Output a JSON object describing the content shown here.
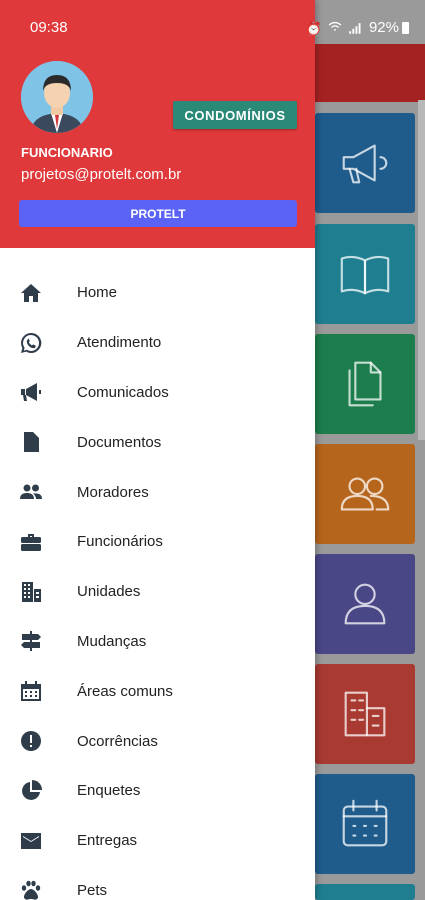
{
  "status_bar": {
    "time": "09:38",
    "battery": "92%"
  },
  "drawer": {
    "condominios_button": "CONDOMÍNIOS",
    "role": "FUNCIONARIO",
    "email": "projetos@protelt.com.br",
    "company_button": "PROTELT"
  },
  "menu": [
    {
      "label": "Home",
      "icon": "home-icon"
    },
    {
      "label": "Atendimento",
      "icon": "whatsapp-icon"
    },
    {
      "label": "Comunicados",
      "icon": "megaphone-icon"
    },
    {
      "label": "Documentos",
      "icon": "document-icon"
    },
    {
      "label": "Moradores",
      "icon": "people-icon"
    },
    {
      "label": "Funcionários",
      "icon": "briefcase-icon"
    },
    {
      "label": "Unidades",
      "icon": "building-icon"
    },
    {
      "label": "Mudanças",
      "icon": "signpost-icon"
    },
    {
      "label": "Áreas comuns",
      "icon": "calendar-icon"
    },
    {
      "label": "Ocorrências",
      "icon": "alert-icon"
    },
    {
      "label": "Enquetes",
      "icon": "pie-chart-icon"
    },
    {
      "label": "Entregas",
      "icon": "mail-icon"
    },
    {
      "label": "Pets",
      "icon": "paw-icon"
    }
  ],
  "background_tiles": [
    {
      "icon": "megaphone-icon",
      "color": "#1f5c8c"
    },
    {
      "icon": "book-icon",
      "color": "#1f7f91"
    },
    {
      "icon": "documents-icon",
      "color": "#1d7d4c"
    },
    {
      "icon": "people-icon",
      "color": "#b6651c"
    },
    {
      "icon": "person-icon",
      "color": "#4a4787"
    },
    {
      "icon": "building-icon",
      "color": "#a83a32"
    },
    {
      "icon": "calendar-icon",
      "color": "#1f5c8c"
    }
  ],
  "colors": {
    "header": "#e0393b",
    "condominios_button": "#2b8a77",
    "company_button": "#5a63f6",
    "menu_icon": "#2f3d4a"
  }
}
